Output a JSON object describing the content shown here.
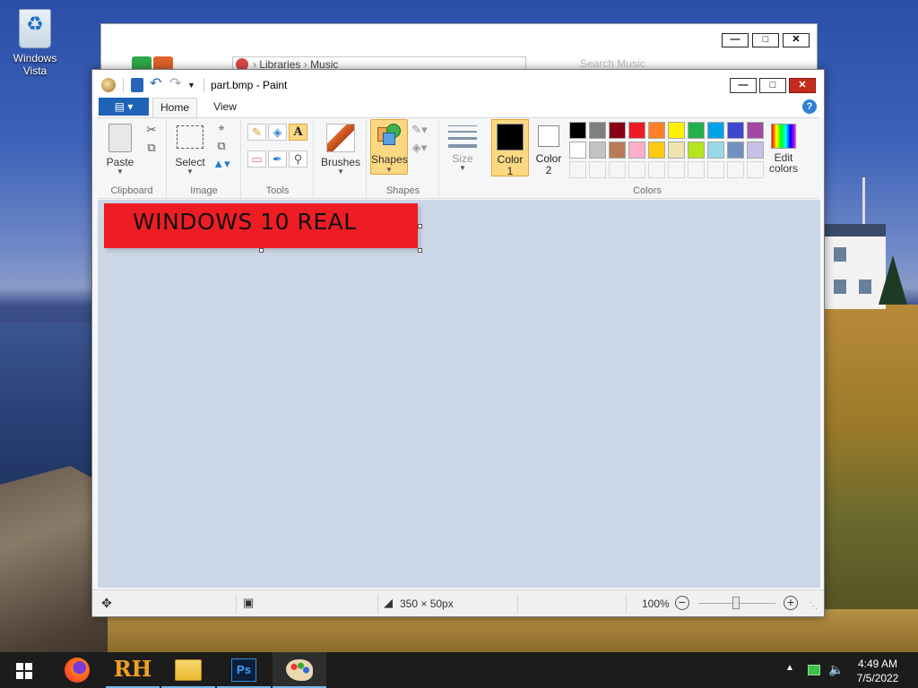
{
  "desktop": {
    "icon_label": "Windows\nVista"
  },
  "explorer_bg": {
    "path": [
      "Libraries",
      "Music"
    ],
    "search_placeholder": "Search Music"
  },
  "paint": {
    "title": "part.bmp - Paint",
    "tabs": [
      {
        "label": "Home",
        "active": true
      },
      {
        "label": "View",
        "active": false
      }
    ],
    "groups": {
      "clipboard": "Clipboard",
      "image": "Image",
      "tools": "Tools",
      "shapes": "Shapes",
      "colors": "Colors"
    },
    "buttons": {
      "paste": "Paste",
      "select": "Select",
      "brushes": "Brushes",
      "shapes": "Shapes",
      "size": "Size",
      "color1_a": "Color",
      "color1_b": "1",
      "color2_a": "Color",
      "color2_b": "2",
      "edit_colors_a": "Edit",
      "edit_colors_b": "colors"
    },
    "color1": "#000000",
    "color2": "#ffffff",
    "palette_row1": [
      "#000000",
      "#7f7f7f",
      "#880015",
      "#ed1c24",
      "#ff7f27",
      "#fff200",
      "#22b14c",
      "#00a2e8",
      "#3f48cc",
      "#a349a4"
    ],
    "palette_row2": [
      "#ffffff",
      "#c3c3c3",
      "#b97a57",
      "#ffaec9",
      "#ffc90e",
      "#efe4b0",
      "#b5e61d",
      "#99d9ea",
      "#7092be",
      "#c8bfe7"
    ],
    "palette_row3": [
      "#f5f6f7",
      "#f5f6f7",
      "#f5f6f7",
      "#f5f6f7",
      "#f5f6f7",
      "#f5f6f7",
      "#f5f6f7",
      "#f5f6f7",
      "#f5f6f7",
      "#f5f6f7"
    ],
    "image": {
      "text": "WINDOWS 10 REAL",
      "fill": "#ee1d24"
    },
    "status": {
      "dimensions": "350 × 50px",
      "zoom": "100%"
    }
  },
  "taskbar": {
    "apps": [
      "start",
      "firefox",
      "rh",
      "explorer",
      "photoshop",
      "paint"
    ],
    "rh_label": "RH",
    "ps_label": "Ps",
    "time": "4:49 AM",
    "date": "7/5/2022"
  }
}
